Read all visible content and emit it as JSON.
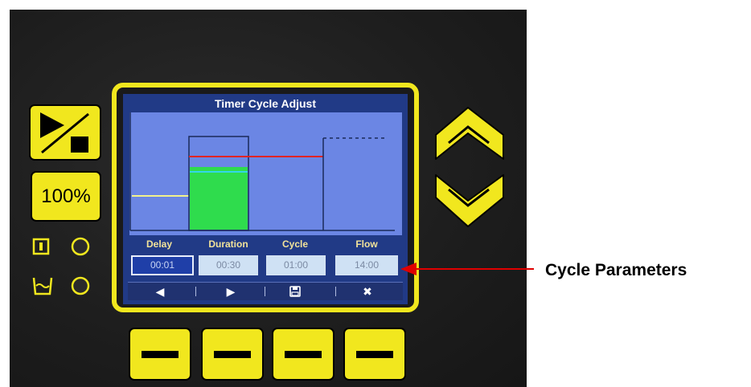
{
  "screen": {
    "title": "Timer Cycle Adjust"
  },
  "params": {
    "labels": [
      "Delay",
      "Duration",
      "Cycle",
      "Flow"
    ],
    "values": [
      "00:01",
      "00:30",
      "01:00",
      "14:00"
    ],
    "selected_index": 0
  },
  "nav": {
    "icons": [
      "left-arrow-icon",
      "right-arrow-icon",
      "save-icon",
      "cancel-icon"
    ],
    "glyphs": [
      "◀",
      "▶",
      "💾",
      "✖"
    ]
  },
  "keys": {
    "speed_label": "100%"
  },
  "callout": {
    "text": "Cycle Parameters"
  },
  "colors": {
    "key_yellow": "#f1e71e",
    "lcd_blue": "#213a86",
    "graph_blue": "#6b86e4",
    "green_fill": "#2fdc4d",
    "red_line": "#e02424",
    "yellow_line": "#f2f28c",
    "arrow_red": "#e00000"
  }
}
